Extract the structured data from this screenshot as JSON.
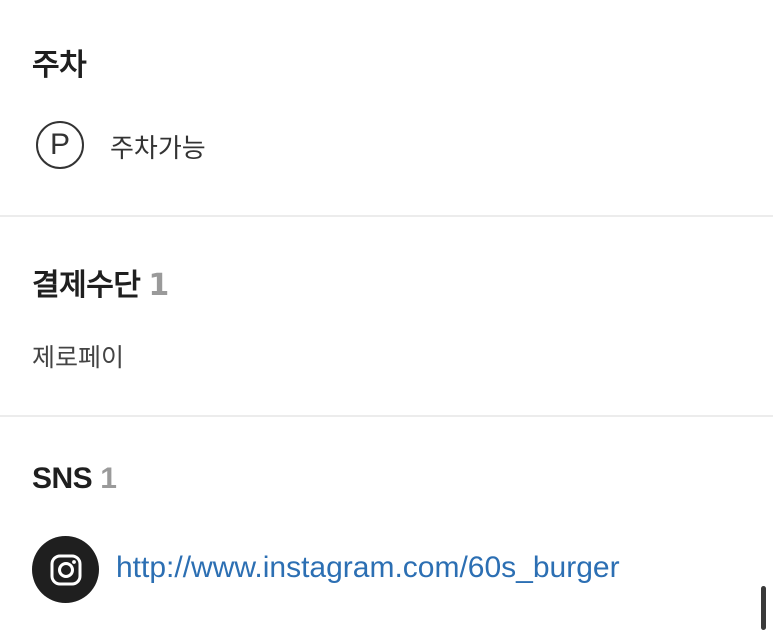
{
  "parking": {
    "title": "주차",
    "icon": "parking-icon",
    "icon_glyph": "P",
    "status": "주차가능"
  },
  "payment": {
    "title": "결제수단",
    "count": "1",
    "methods": [
      "제로페이"
    ]
  },
  "sns": {
    "title": "SNS",
    "count": "1",
    "icon": "instagram-icon",
    "link": "http://www.instagram.com/60s_burger"
  },
  "colors": {
    "link": "#2c6fb3",
    "count": "#9a9a9a",
    "divider": "#ececec",
    "icon_badge": "#1f1f1f"
  }
}
